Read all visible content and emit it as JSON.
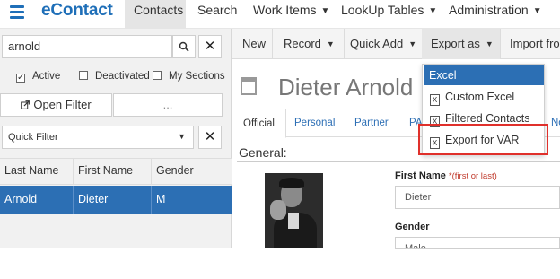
{
  "app": {
    "brand": "eContact"
  },
  "nav": [
    {
      "label": "Contacts",
      "caret": false
    },
    {
      "label": "Search",
      "caret": false
    },
    {
      "label": "Work Items",
      "caret": true
    },
    {
      "label": "LookUp Tables",
      "caret": true
    },
    {
      "label": "Administration",
      "caret": true
    }
  ],
  "left": {
    "search_value": "arnold",
    "filters": {
      "active": "Active",
      "deactivated": "Deactivated",
      "my_sections": "My Sections",
      "active_checked": true
    },
    "open_filter": "Open Filter",
    "more": "...",
    "quick_filter": "Quick Filter",
    "columns": [
      "Last Name",
      "First Name",
      "Gender"
    ],
    "rows": [
      {
        "last": "Arnold",
        "first": "Dieter",
        "gender": "M"
      }
    ]
  },
  "toolbar": {
    "new": "New",
    "record": "Record",
    "quick_add": "Quick Add",
    "export_as": "Export as",
    "import_from": "Import from"
  },
  "record": {
    "name": "Dieter Arnold",
    "tabs": [
      "Official",
      "Personal",
      "Partner",
      "PA",
      "No"
    ],
    "section": "General:",
    "first_name_label": "First Name",
    "first_name_hint": "*(first or last)",
    "first_name_value": "Dieter",
    "gender_label": "Gender",
    "gender_value": "Male"
  },
  "export_menu": {
    "items": [
      "Excel",
      "Custom Excel",
      "Filtered Contacts",
      "Export for VAR"
    ],
    "highlighted": "Excel",
    "callout_item": "Export for VAR",
    "callout_color": "#e0302b"
  },
  "colors": {
    "accent": "#1f6fb8",
    "selected_row": "#2c6fb4"
  }
}
